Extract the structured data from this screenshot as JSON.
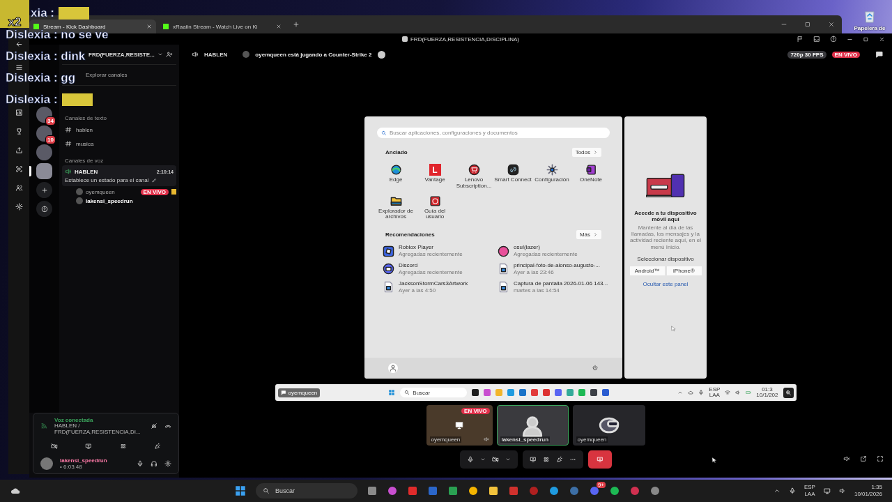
{
  "desktop": {
    "icon_label": "Papelera de"
  },
  "browser": {
    "tabs": [
      {
        "label": "Stream - Kick Dashboard",
        "selected": true
      },
      {
        "label": "xRaaiin Stream - Watch Live on Ki",
        "selected": false
      }
    ]
  },
  "chat_overlay": {
    "combo": "x2",
    "messages": [
      {
        "text": "xia :",
        "kind": "emote"
      },
      {
        "text": "Dislexia : no se ve",
        "kind": "text"
      },
      {
        "text": "Dislexia : dink",
        "kind": "text"
      },
      {
        "text": "Dislexia : gg",
        "kind": "text"
      },
      {
        "text": "Dislexia :",
        "kind": "emote"
      }
    ]
  },
  "discord": {
    "title": "FRD(FUERZA,RESISTENCIA,DISCIPLINA)",
    "server_name": "FRD(FUERZA,RESISTE...",
    "explore": "Explorar canales",
    "servers": [
      {
        "badge": "34",
        "selected": false
      },
      {
        "badge": "10",
        "selected": false
      },
      {
        "selected": false
      },
      {
        "selected": true
      }
    ],
    "text_category": "Canales de texto",
    "text_channels": [
      "hablen",
      "musica"
    ],
    "voice_category": "Canales de voz",
    "voice_channel": {
      "name": "HABLEN",
      "timer": "2:10:14",
      "status": "Establece un estado para el canal",
      "members": [
        {
          "name": "oyemqueen",
          "live_badge": "EN VIVO"
        },
        {
          "name": "lakensi_speedrun"
        }
      ]
    },
    "stream_header": {
      "channel": "HABLEN",
      "activity": "oyemqueen está jugando a Counter-Strike 2",
      "quality": "720p 30 FPS",
      "live_badge": "EN VIVO"
    },
    "voice_panel": {
      "title": "Voz conectada",
      "location": "HABLEN / FRD(FUERZA,RESISTENCIA,DI...",
      "user": "lakensi_speedrun",
      "duration": "• 6:03:48"
    },
    "participants": [
      {
        "name": "oyemqueen",
        "live_badge": "EN VIVO",
        "kind": "screen",
        "selected": false
      },
      {
        "name": "lakensi_speedrun",
        "kind": "avatar",
        "selected": true
      },
      {
        "name": "oyemqueen",
        "kind": "camera",
        "selected": false
      }
    ]
  },
  "start_menu": {
    "search_placeholder": "Buscar aplicaciones, configuraciones y documentos",
    "pinned_title": "Anclado",
    "all_button": "Todos",
    "pinned": [
      {
        "label": "Edge",
        "kind": "globe"
      },
      {
        "label": "Vantage",
        "kind": "letter",
        "glyph": "L"
      },
      {
        "label": "Lenovo Subscription...",
        "kind": "cart"
      },
      {
        "label": "Smart Connect",
        "kind": "link"
      },
      {
        "label": "Configuración",
        "kind": "gear"
      },
      {
        "label": "OneNote",
        "kind": "notebook"
      },
      {
        "label": "Explorador de archivos",
        "kind": "folder"
      },
      {
        "label": "Guía del usuario",
        "kind": "book"
      }
    ],
    "recommended_title": "Recomendaciones",
    "more_button": "Más",
    "recommended": [
      {
        "title": "Roblox Player",
        "subtitle": "Agregadas recientemente",
        "kind": "tile"
      },
      {
        "title": "osu!(lazer)",
        "subtitle": "Agregadas recientemente",
        "kind": "disc"
      },
      {
        "title": "Discord",
        "subtitle": "Agregadas recientemente",
        "kind": "bubble"
      },
      {
        "title": "principal-foto-de-alonso-augusto-...",
        "subtitle": "Ayer a las 23:46",
        "kind": "image"
      },
      {
        "title": "JacksonStormCars3Artwork",
        "subtitle": "Ayer a las 4:50",
        "kind": "image"
      },
      {
        "title": "Captura de pantalla 2026-01-06 143...",
        "subtitle": "martes a las 14:54",
        "kind": "image"
      }
    ],
    "phone_panel": {
      "title": "Accede a tu dispositivo móvil aquí",
      "body": "Mantente al día de las llamadas, los mensajes y la actividad reciente aquí, en el menú Inicio.",
      "select_label": "Seleccionar dispositivo",
      "devices": [
        "Android™",
        "iPhone®"
      ],
      "hide_link": "Ocultar este panel"
    }
  },
  "streamed_taskbar": {
    "user_chip": "oyemqueen",
    "search": "Buscar",
    "lang": "ESP",
    "region": "LAA",
    "time": "01:3",
    "date": "10/1/202"
  },
  "taskbar": {
    "search": "Buscar",
    "discord_badge": "9+",
    "lang": "ESP",
    "region": "LAA",
    "time": "1:35",
    "date": "10/01/2026"
  }
}
